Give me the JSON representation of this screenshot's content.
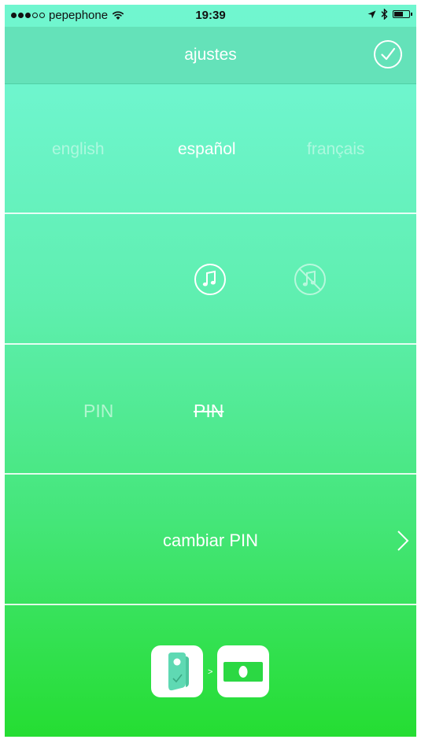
{
  "status_bar": {
    "carrier": "pepephone",
    "time": "19:39",
    "signal_dots_filled": 3,
    "signal_dots_total": 5
  },
  "navbar": {
    "title": "ajustes",
    "confirm_icon": "checkmark-circle-icon"
  },
  "language": {
    "options": [
      "english",
      "español",
      "français"
    ],
    "selected": "español"
  },
  "sound": {
    "options": [
      "music-on-icon",
      "music-off-icon"
    ],
    "selected": "music-on-icon"
  },
  "pin": {
    "options": [
      "PIN",
      "PIN"
    ],
    "selected_index": 1
  },
  "change_pin": {
    "label": "cambiar PIN",
    "chevron_icon": "chevron-right-icon"
  },
  "apps": {
    "items": [
      "tag-device-icon",
      "payment-card-icon"
    ],
    "separator": ">"
  },
  "colors": {
    "navbar": "#64e2b9",
    "gradient_top": "#70f6cf",
    "gradient_bottom": "#25dd32"
  }
}
